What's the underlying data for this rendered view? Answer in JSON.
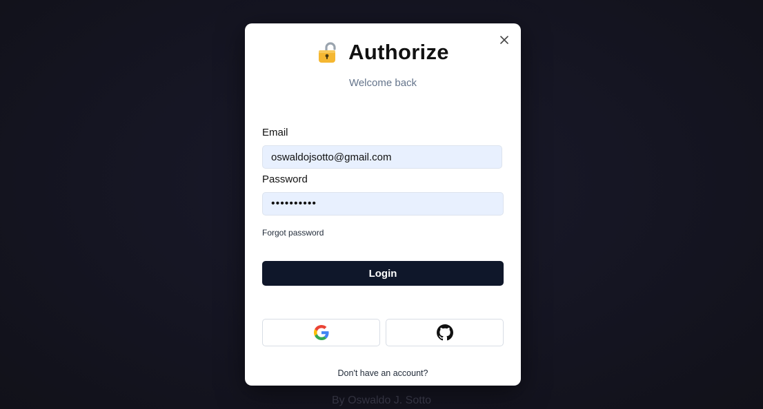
{
  "footer": {
    "credit": "By Oswaldo J. Sotto"
  },
  "modal": {
    "title": "Authorize",
    "title_icon": "lock-icon",
    "subtitle": "Welcome back",
    "close_icon": "close-icon",
    "email": {
      "label": "Email",
      "value": "oswaldojsotto@gmail.com"
    },
    "password": {
      "label": "Password",
      "value": "••••••••••"
    },
    "forgot_password": "Forgot password",
    "login_label": "Login",
    "social": {
      "google_icon": "google-icon",
      "github_icon": "github-icon"
    },
    "signup_prompt": "Don't have an account?"
  },
  "colors": {
    "background": "#151522",
    "primary_button": "#0f172a",
    "input_fill": "#e8f0fe",
    "subtitle": "#64748b"
  }
}
